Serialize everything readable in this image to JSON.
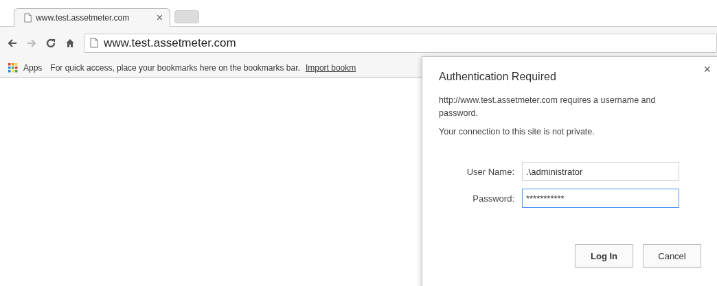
{
  "tabs": [
    {
      "title": "www.test.assetmeter.com",
      "close": "×",
      "selected": true
    }
  ],
  "toolbar": {
    "back_disabled": false,
    "forward_disabled": true,
    "address": "www.test.assetmeter.com"
  },
  "bookmarks_bar": {
    "apps": "Apps",
    "hint": "For quick access, place your bookmarks here on the bookmarks bar.",
    "link": "Import bookm"
  },
  "dialog": {
    "title": "Authentication Required",
    "close": "×",
    "message": "http://www.test.assetmeter.com requires a username and password.",
    "notice": "Your connection to this site is not private.",
    "fields": [
      {
        "label": "User Name:",
        "value": ".\\administrator",
        "focused": false
      },
      {
        "label": "Password:",
        "value": "***********",
        "focused": true
      }
    ],
    "buttons": [
      {
        "label": "Log In",
        "default": true
      },
      {
        "label": "Cancel",
        "default": false
      }
    ]
  }
}
